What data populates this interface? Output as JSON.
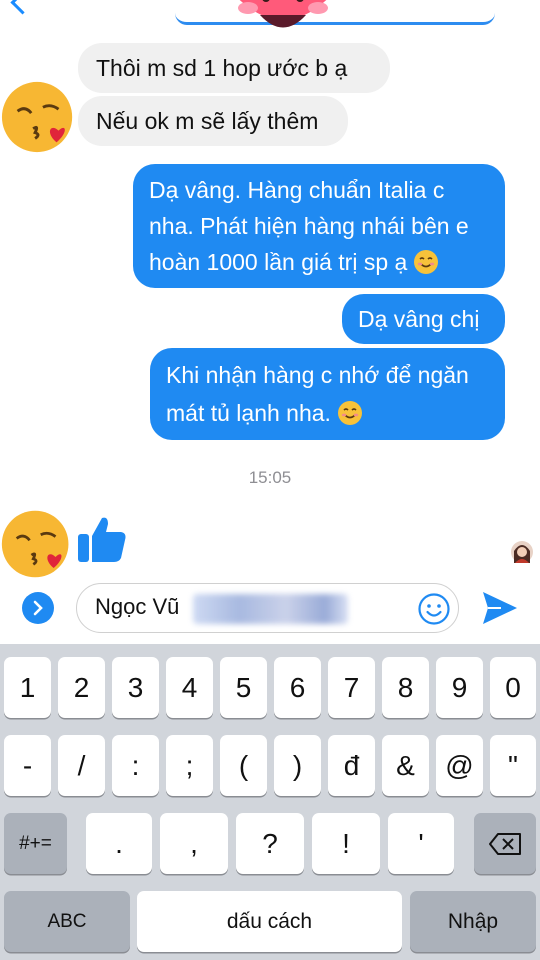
{
  "messages": {
    "incoming": [
      "Thôi m sd 1 hop",
      "Nếu ok m sẽ lấy thêm"
    ],
    "incoming_partial_tail": "ước b ạ",
    "outgoing": [
      {
        "lines": [
          "Dạ vâng. Hàng chuẩn Italia c",
          "nha. Phát hiện hàng nhái bên e",
          "hoàn 1000 lần giá trị sp ạ"
        ],
        "emoji": "smiling-face-emoji"
      },
      {
        "lines": [
          "Dạ vâng chị"
        ]
      },
      {
        "lines": [
          "Khi nhận hàng c nhớ để ngăn",
          "mát tủ lạnh nha."
        ],
        "emoji": "smiling-face-emoji"
      }
    ]
  },
  "timestamp": "15:05",
  "composer": {
    "text": "Ngọc Vũ",
    "blurred_value": "091.663.1192"
  },
  "keyboard": {
    "row1": [
      "1",
      "2",
      "3",
      "4",
      "5",
      "6",
      "7",
      "8",
      "9",
      "0"
    ],
    "row2": [
      "-",
      "/",
      ":",
      ";",
      "(",
      ")",
      "đ",
      "&",
      "@",
      "\""
    ],
    "row3": [
      ".",
      ",",
      "?",
      "!",
      "'"
    ],
    "switch_label": "#+=",
    "abc_label": "ABC",
    "space_label": "dấu cách",
    "return_label": "Nhập"
  },
  "icons": [
    "back-chevron-icon",
    "kiss-heart-emoji",
    "thumbs-up-icon",
    "expand-icon",
    "emoji-icon",
    "send-icon",
    "backspace-icon",
    "avatar"
  ],
  "colors": {
    "accent": "#1f8af2",
    "incoming_bubble": "#f0f0f0",
    "keyboard_bg": "#d1d5db"
  }
}
